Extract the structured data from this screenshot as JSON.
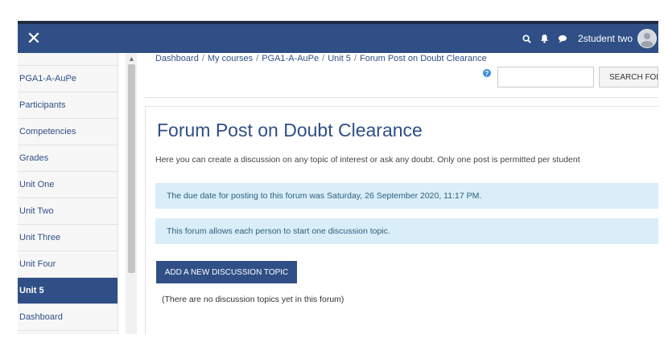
{
  "navbar": {
    "close_symbol": "✕",
    "user_name": "2student two",
    "icons": [
      "search-icon",
      "bell-icon",
      "chat-icon",
      "avatar"
    ],
    "bg_color": "#2f4f86"
  },
  "sidebar": {
    "items": [
      {
        "label": "PGA1-A-AuPe"
      },
      {
        "label": "Participants"
      },
      {
        "label": "Competencies"
      },
      {
        "label": "Grades"
      },
      {
        "label": "Unit One"
      },
      {
        "label": "Unit Two"
      },
      {
        "label": "Unit Three"
      },
      {
        "label": "Unit Four"
      },
      {
        "label": "Unit 5"
      },
      {
        "label": "Dashboard"
      }
    ],
    "active_item": "Unit 5"
  },
  "breadcrumb": [
    "Dashboard",
    "My courses",
    "PGA1-A-AuPe",
    "Unit 5",
    "Forum Post on Doubt Clearance"
  ],
  "search": {
    "help_symbol": "?",
    "value": "",
    "button_label": "SEARCH FOR"
  },
  "main": {
    "title": "Forum Post on Doubt Clearance",
    "intro": "Here you can create a discussion on any topic of interest or ask any doubt. Only one post is permitted per student",
    "notice_due": "The due date for posting to this forum was Saturday, 26 September 2020, 11:17 PM.",
    "notice_one_topic": "This forum allows each person to start one discussion topic.",
    "add_button_label": "ADD A NEW DISCUSSION TOPIC",
    "empty_message": "(There are no discussion topics yet in this forum)"
  },
  "colors": {
    "accent": "#2f4f86",
    "notice_bg": "#d9eef8"
  }
}
